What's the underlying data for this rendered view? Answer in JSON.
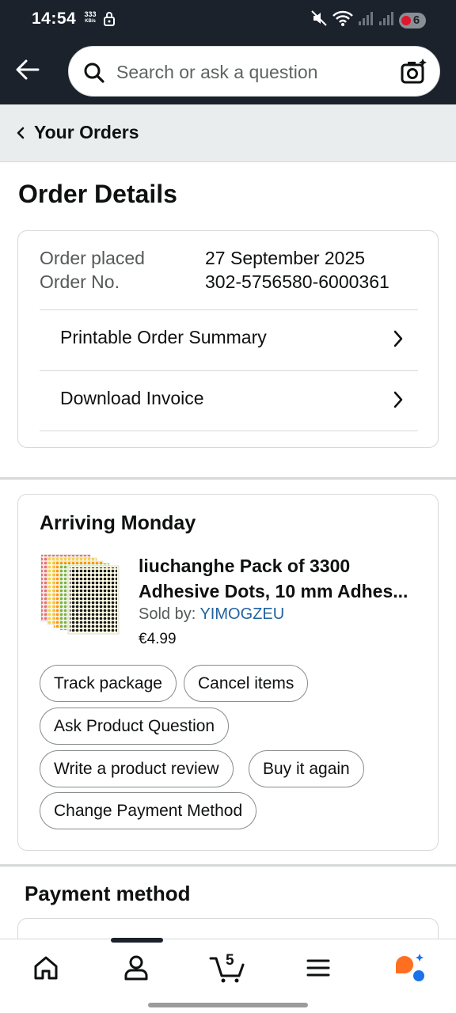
{
  "status_bar": {
    "time": "14:54",
    "speed_value": "333",
    "speed_unit": "KB/s",
    "battery": "6"
  },
  "search": {
    "placeholder": "Search or ask a question"
  },
  "breadcrumb": {
    "label": "Your Orders"
  },
  "page": {
    "title": "Order Details"
  },
  "order_summary": {
    "placed_label": "Order placed",
    "placed_value": "27 September 2025",
    "number_label": "Order No.",
    "number_value": "302-5756580-6000361",
    "links": [
      {
        "label": "Printable Order Summary"
      },
      {
        "label": "Download Invoice"
      }
    ]
  },
  "shipment": {
    "status": "Arriving Monday",
    "product": {
      "title_line1": "liuchanghe Pack of 3300",
      "title_line2": "Adhesive Dots, 10 mm Adhes...",
      "sold_by_label": "Sold by:",
      "seller": "YIMOGZEU",
      "price": "€4.99"
    },
    "actions": [
      {
        "label": "Track package"
      },
      {
        "label": "Cancel items"
      },
      {
        "label": "Ask Product Question"
      },
      {
        "label": "Write a product review"
      },
      {
        "label": "Buy it again"
      },
      {
        "label": "Change Payment Method"
      }
    ]
  },
  "payment": {
    "title": "Payment method"
  },
  "bottom_nav": {
    "cart_count": "5",
    "items": [
      "home-icon",
      "account-icon",
      "cart-icon",
      "menu-icon",
      "rufus-icon"
    ]
  },
  "colors": {
    "header_bg": "#1b222c",
    "link": "#2162a1",
    "rufus_orange": "#ff6f1f",
    "rufus_blue": "#1a73e8"
  }
}
